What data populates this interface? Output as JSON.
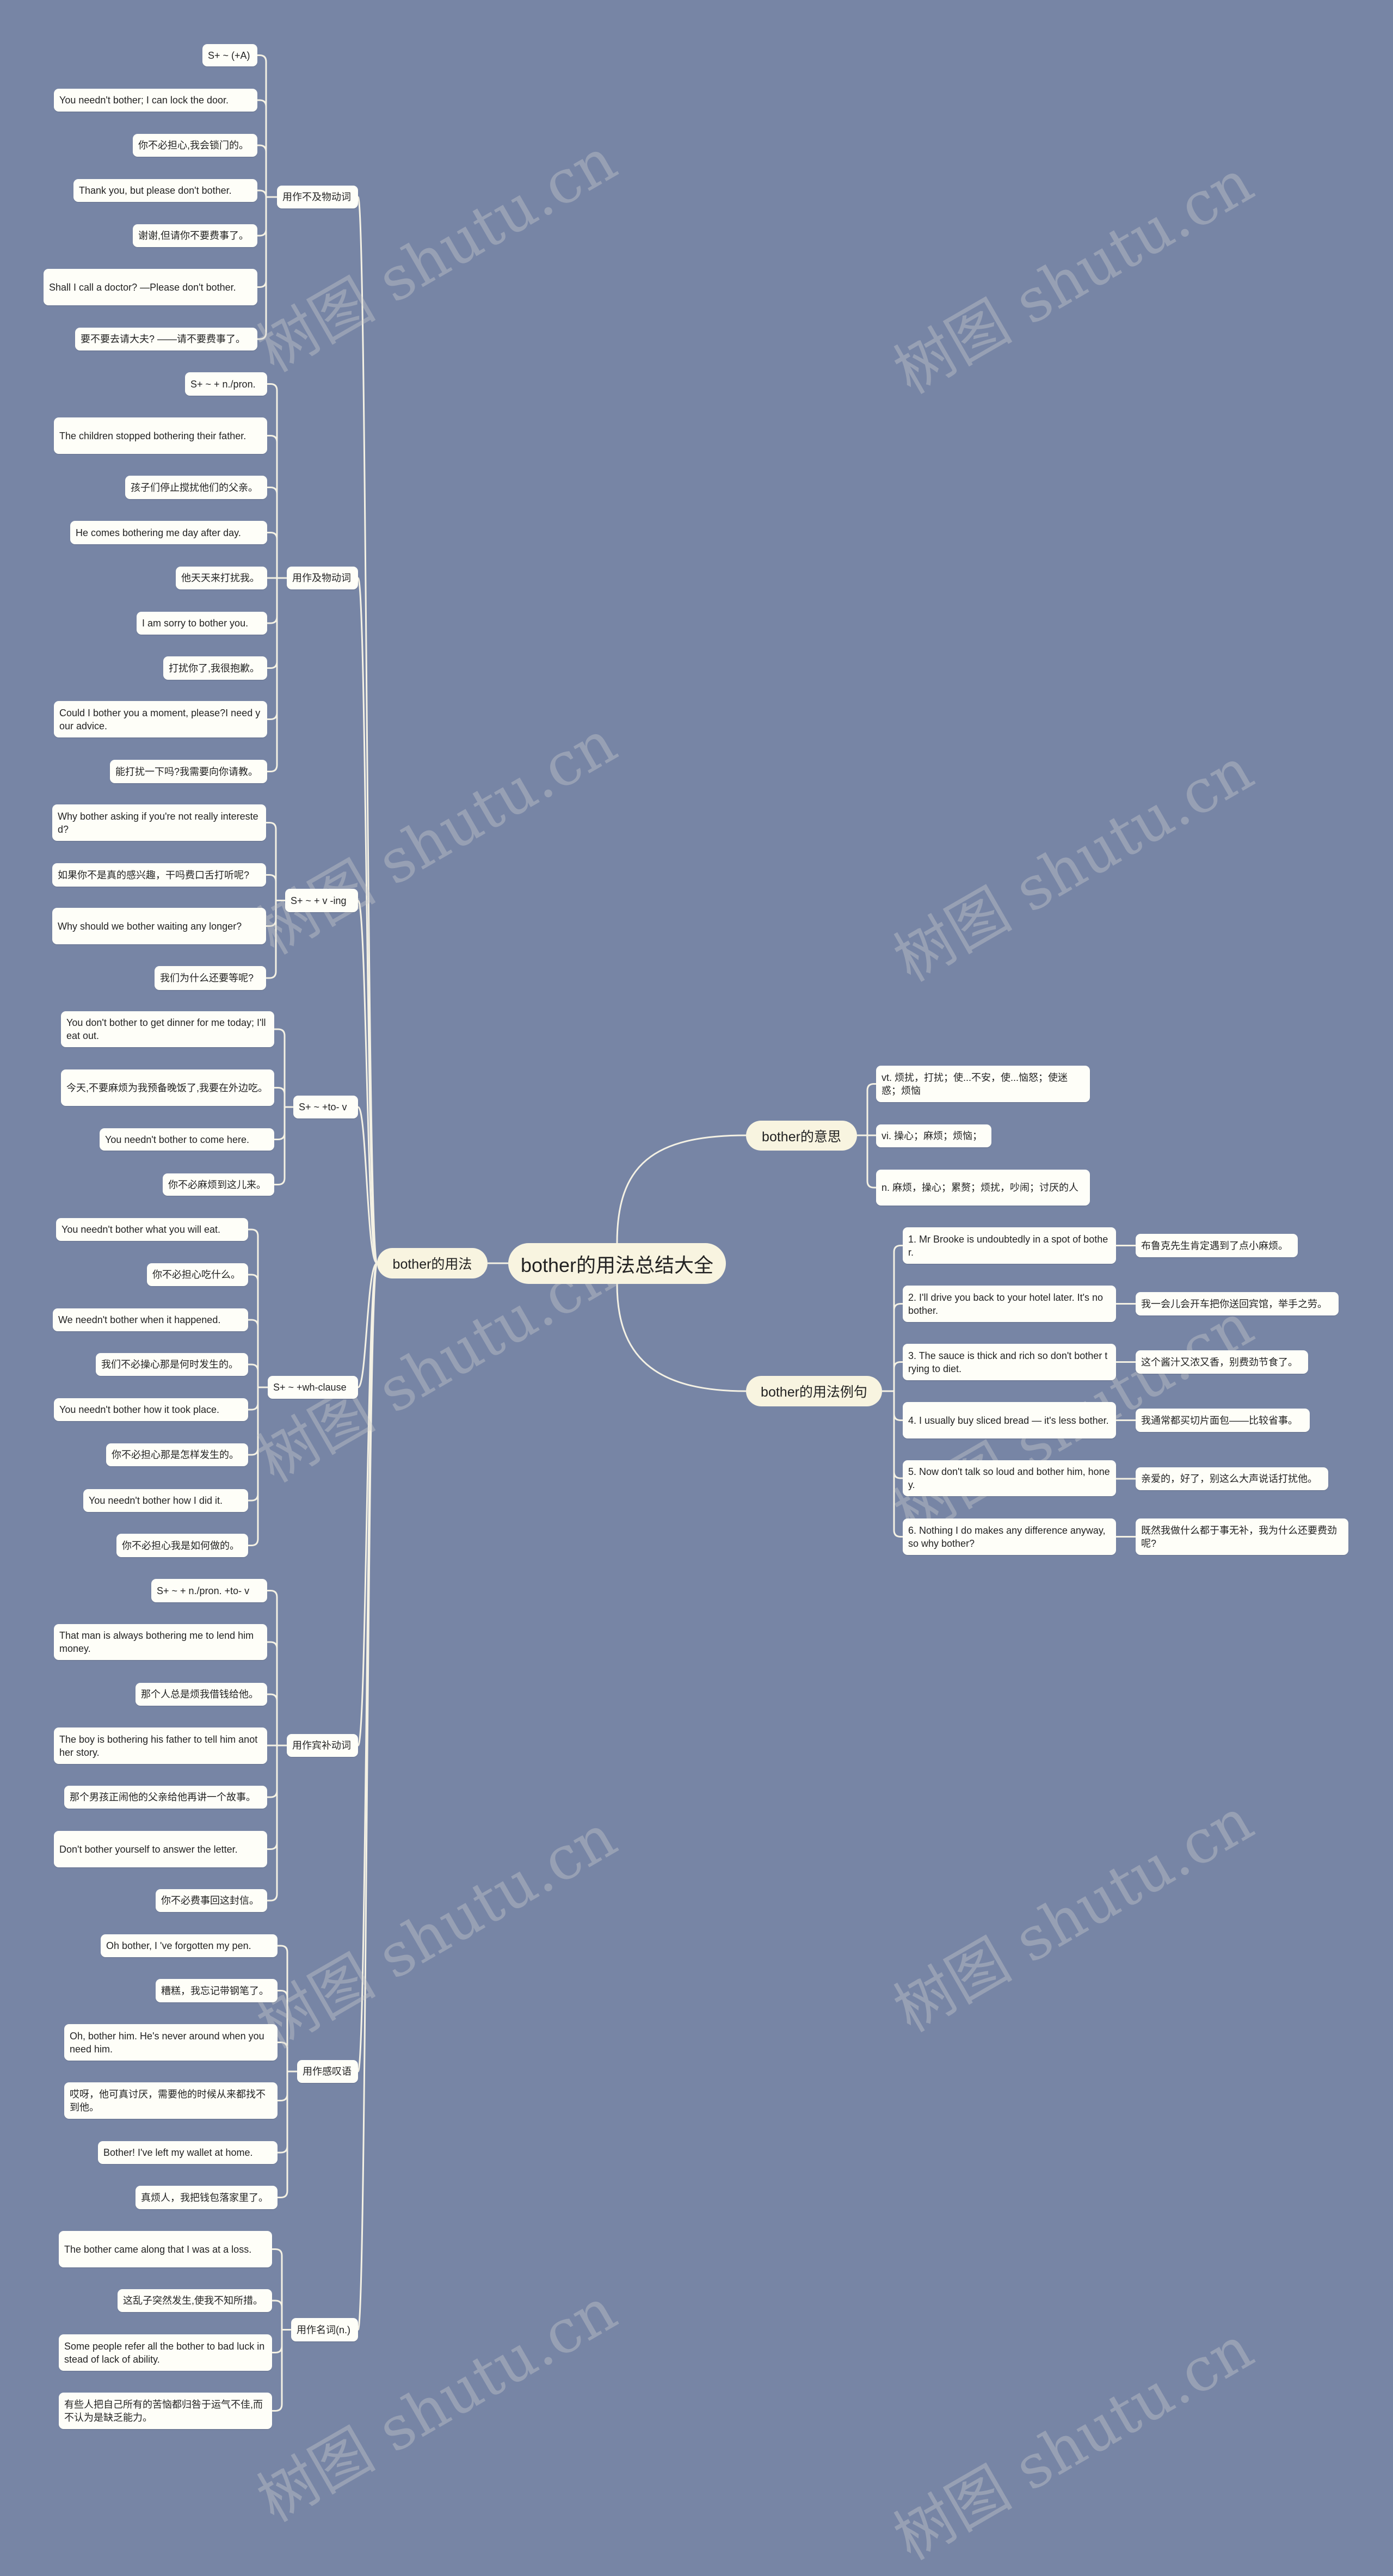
{
  "root": "bother的用法总结大全",
  "usage_branch": "bother的用法",
  "meaning_branch": "bother的意思",
  "examples_branch": "bother的用法例句",
  "watermark": "树图 shutu.cn",
  "colors": {
    "background": "#7785a5",
    "node": "#fefef8",
    "main_node": "#f8f4e0",
    "line": "#f4f1e4"
  },
  "groups": [
    {
      "label": "用作不及物动词",
      "items": [
        "S+ ~ (+A)",
        "You needn't bother; I can lock the door.",
        "你不必担心,我会锁门的。",
        "Thank you, but please don't bother.",
        "谢谢,但请你不要费事了。",
        "Shall I call a doctor? —Please don't bother.",
        "要不要去请大夫? ——请不要费事了。"
      ]
    },
    {
      "label": "用作及物动词",
      "items": [
        "S+ ~ + n./pron.",
        "The children stopped bothering their father.",
        "孩子们停止搅扰他们的父亲。",
        "He comes bothering me day after day.",
        "他天天来打扰我。",
        "I am sorry to bother you.",
        "打扰你了,我很抱歉。",
        "Could I bother you a moment, please?I need your advice.",
        "能打扰一下吗?我需要向你请教。"
      ]
    },
    {
      "label": "S+ ~ + v -ing",
      "items": [
        "Why bother asking if you're not really interested?",
        "如果你不是真的感兴趣，干吗费口舌打听呢?",
        "Why should we bother waiting any longer?",
        "我们为什么还要等呢?"
      ]
    },
    {
      "label": "S+ ~ +to- v",
      "items": [
        "You don't bother to get dinner for me today; I'll eat out.",
        "今天,不要麻烦为我预备晚饭了,我要在外边吃。",
        "You needn't bother to come here.",
        "你不必麻烦到这儿来。"
      ]
    },
    {
      "label": "S+ ~ +wh-clause",
      "items": [
        "You needn't bother what you will eat.",
        "你不必担心吃什么。",
        "We needn't bother when it happened.",
        "我们不必操心那是何时发生的。",
        "You needn't bother how it took place.",
        "你不必担心那是怎样发生的。",
        "You needn't bother how I did it.",
        "你不必担心我是如何做的。"
      ]
    },
    {
      "label": "用作宾补动词",
      "items": [
        "S+ ~ + n./pron. +to- v",
        "That man is always bothering me to lend him money.",
        "那个人总是烦我借钱给他。",
        "The boy is bothering his father to tell him another story.",
        "那个男孩正闹他的父亲给他再讲一个故事。",
        "Don't bother yourself to answer the letter.",
        "你不必费事回这封信。"
      ]
    },
    {
      "label": "用作感叹语",
      "items": [
        "Oh bother, I 've forgotten my pen.",
        "糟糕，我忘记带钢笔了。",
        "Oh, bother him. He's never around when you need him.",
        "哎呀，他可真讨厌，需要他的时候从来都找不到他。",
        "Bother! I've left my wallet at home.",
        "真烦人，我把钱包落家里了。"
      ]
    },
    {
      "label": "用作名词(n.)",
      "items": [
        "The bother came along that I was at a loss.",
        "这乱子突然发生,使我不知所措。",
        "Some people refer all the bother to bad luck instead of lack of ability.",
        "有些人把自己所有的苦恼都归咎于运气不佳,而不认为是缺乏能力。"
      ]
    }
  ],
  "meanings": [
    "vt. 烦扰，打扰；使...不安，使...恼怒；使迷惑；烦恼",
    "vi. 操心；麻烦；烦恼；",
    "n. 麻烦，操心；累赘；烦扰，吵闹；讨厌的人"
  ],
  "examples": [
    {
      "en": "1. Mr Brooke is undoubtedly in a spot of bother.",
      "zh": "布鲁克先生肯定遇到了点小麻烦。"
    },
    {
      "en": "2. I'll drive you back to your hotel later. It's no bother.",
      "zh": "我一会儿会开车把你送回宾馆，举手之劳。"
    },
    {
      "en": "3. The sauce is thick and rich so don't bother trying to diet.",
      "zh": "这个酱汁又浓又香，别费劲节食了。"
    },
    {
      "en": "4. I usually buy sliced bread — it's less bother.",
      "zh": "我通常都买切片面包——比较省事。"
    },
    {
      "en": "5. Now don't talk so loud and bother him, honey.",
      "zh": "亲爱的，好了，别这么大声说话打扰他。"
    },
    {
      "en": "6. Nothing I do makes any difference anyway, so why bother?",
      "zh": "既然我做什么都于事无补，我为什么还要费劲呢?"
    }
  ]
}
